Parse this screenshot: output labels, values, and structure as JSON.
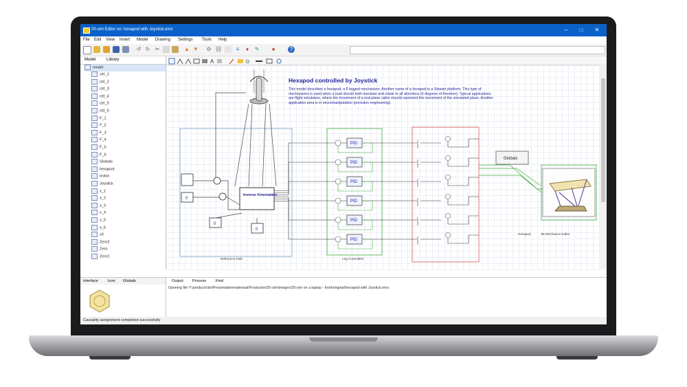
{
  "window": {
    "title": "20-sim Editor on: hexapod with Joystick.emx",
    "controls": [
      "–",
      "□",
      "✕"
    ]
  },
  "menu": [
    "File",
    "Edit",
    "View",
    "Insert",
    "Model",
    "Drawing",
    "Settings",
    "Tools",
    "Help"
  ],
  "left_tabs": [
    "Model",
    "Library"
  ],
  "tree": {
    "root": "model",
    "items": [
      "ctrl_1",
      "ctrl_2",
      "ctrl_3",
      "ctrl_4",
      "ctrl_5",
      "ctrl_6",
      "F_1",
      "F_2",
      "F_3",
      "F_4",
      "F_5",
      "F_6",
      "Globals",
      "hexapod",
      "invkin",
      "Joystick",
      "x_1",
      "x_2",
      "x_3",
      "x_4",
      "x_5",
      "x_6",
      "z0",
      "Zero2",
      "Zero",
      "Zero1"
    ]
  },
  "bottom_left_tabs": [
    "Interface",
    "Icon",
    "Globals"
  ],
  "output_tabs": [
    "Output",
    "Process",
    "Find"
  ],
  "output_text": "Opening file Y:\\products\\bv\\Presentationmateriaal\\Producten\\20-sim\\images\\20-sim on a laptop - front\\original\\hexapod with Joystick.emx",
  "status": "Causality assignment completed successfully",
  "diagram": {
    "title": "Hexapod controlled by Joystick",
    "description": "This model describes a hexapod, a 6 legged mechanism. Another name of a hexapod is a Stewart platform. This type of mechanisms is used when a load should both translate and rotate in all directions (6 degrees of freedom). Typical applications are flight simulators, where the movement of a real plane cabin should represent the movement of the simulated plane. Another application area is in micromanipulation (precision engineering).",
    "globals_button": "Globals",
    "inverse_kinematics": "Inverse Kinematics",
    "pid_label": "PID",
    "const_label": "0",
    "reference_path_label": "Reference Path",
    "leg_controllers_label": "Leg Controllers",
    "hexapod_label": "Hexapod",
    "editor_label": "3D Mechanics Editor"
  },
  "colors": {
    "titlebar": "#0a62c9",
    "diagram_text": "#1f1f9a",
    "green_group": "#3faa3f",
    "red_group": "#d45050",
    "blue_group": "#7a9ccc"
  }
}
